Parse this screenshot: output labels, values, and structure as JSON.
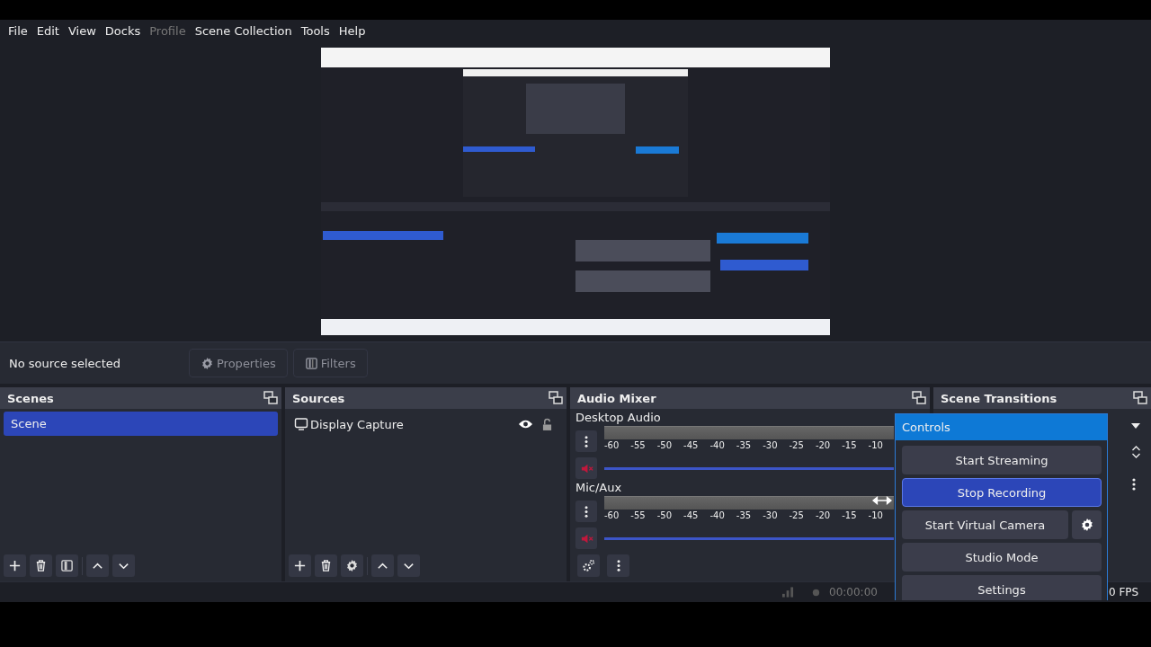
{
  "menu": [
    {
      "label": "File",
      "disabled": false
    },
    {
      "label": "Edit",
      "disabled": false
    },
    {
      "label": "View",
      "disabled": false
    },
    {
      "label": "Docks",
      "disabled": false
    },
    {
      "label": "Profile",
      "disabled": true
    },
    {
      "label": "Scene Collection",
      "disabled": false
    },
    {
      "label": "Tools",
      "disabled": false
    },
    {
      "label": "Help",
      "disabled": false
    }
  ],
  "context_bar": {
    "status": "No source selected",
    "buttons": [
      {
        "label": "Properties",
        "kind": "gear"
      },
      {
        "label": "Filters",
        "kind": "filter"
      }
    ]
  },
  "scenes": {
    "title": "Scenes",
    "items": [
      {
        "label": "Scene",
        "selected": true
      }
    ]
  },
  "sources": {
    "title": "Sources",
    "items": [
      {
        "label": "Display Capture",
        "visible": true,
        "locked": false
      }
    ]
  },
  "audio_mixer": {
    "title": "Audio Mixer",
    "channels": [
      {
        "name": "Desktop Audio",
        "muted": true,
        "level": 1,
        "scale": [
          "-60",
          "-55",
          "-50",
          "-45",
          "-40",
          "-35",
          "-30",
          "-25",
          "-20",
          "-15",
          "-10"
        ]
      },
      {
        "name": "Mic/Aux",
        "muted": true,
        "level": 1,
        "scale": [
          "-60",
          "-55",
          "-50",
          "-45",
          "-40",
          "-35",
          "-30",
          "-25",
          "-20",
          "-15",
          "-10"
        ]
      }
    ]
  },
  "scene_transitions": {
    "title": "Scene Transitions"
  },
  "controls": {
    "title": "Controls",
    "buttons": [
      {
        "label": "Start Streaming",
        "active": false,
        "kind": "plain"
      },
      {
        "label": "Stop Recording",
        "active": true,
        "kind": "plain"
      },
      {
        "label": "Start Virtual Camera",
        "active": false,
        "kind": "with-settings"
      },
      {
        "label": "Studio Mode",
        "active": false,
        "kind": "plain"
      },
      {
        "label": "Settings",
        "active": false,
        "kind": "plain"
      }
    ]
  },
  "status_bar": {
    "time": "00:00:00",
    "fps": "0 FPS"
  }
}
